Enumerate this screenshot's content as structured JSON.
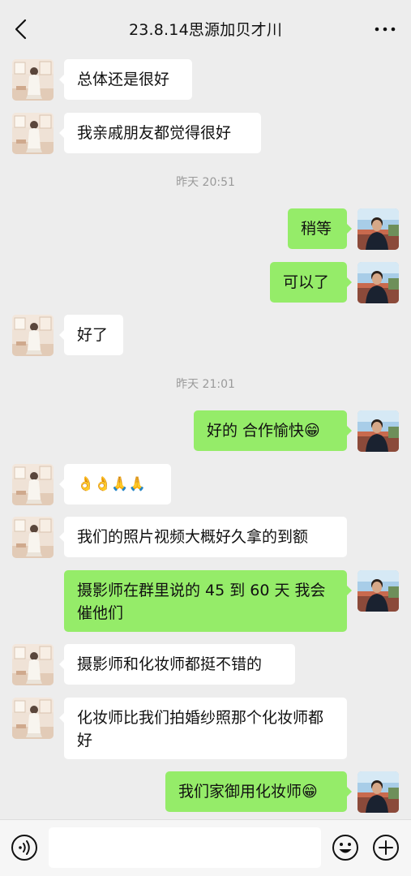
{
  "header": {
    "title": "23.8.14思源加贝才川",
    "back_icon": "chevron-left-icon",
    "more_icon": "more-horizontal-icon"
  },
  "messages": [
    {
      "from": "other",
      "text": "总体还是很好"
    },
    {
      "from": "other",
      "text": "我亲戚朋友都觉得很好"
    },
    {
      "type": "time",
      "text": "昨天 20:51"
    },
    {
      "from": "me",
      "text": "稍等"
    },
    {
      "from": "me",
      "text": "可以了"
    },
    {
      "from": "other",
      "text": "好了"
    },
    {
      "type": "time",
      "text": "昨天 21:01"
    },
    {
      "from": "me",
      "text": "好的 合作愉快😁"
    },
    {
      "from": "other",
      "text": "👌👌🙏🙏"
    },
    {
      "from": "other",
      "text": "我们的照片视频大概好久拿的到额"
    },
    {
      "from": "me",
      "text": "摄影师在群里说的 45 到 60 天 我会催他们"
    },
    {
      "from": "other",
      "text": "摄影师和化妆师都挺不错的"
    },
    {
      "from": "other",
      "text": "化妆师比我们拍婚纱照那个化妆师都好"
    },
    {
      "from": "me",
      "text": "我们家御用化妆师😁"
    }
  ],
  "input_bar": {
    "voice_icon": "voice-icon",
    "input_value": "",
    "emoji_icon": "emoji-icon",
    "plus_icon": "plus-icon"
  },
  "colors": {
    "background": "#ededed",
    "incoming_bubble": "#ffffff",
    "outgoing_bubble": "#95ec69",
    "timestamp": "#9a9a9a"
  }
}
